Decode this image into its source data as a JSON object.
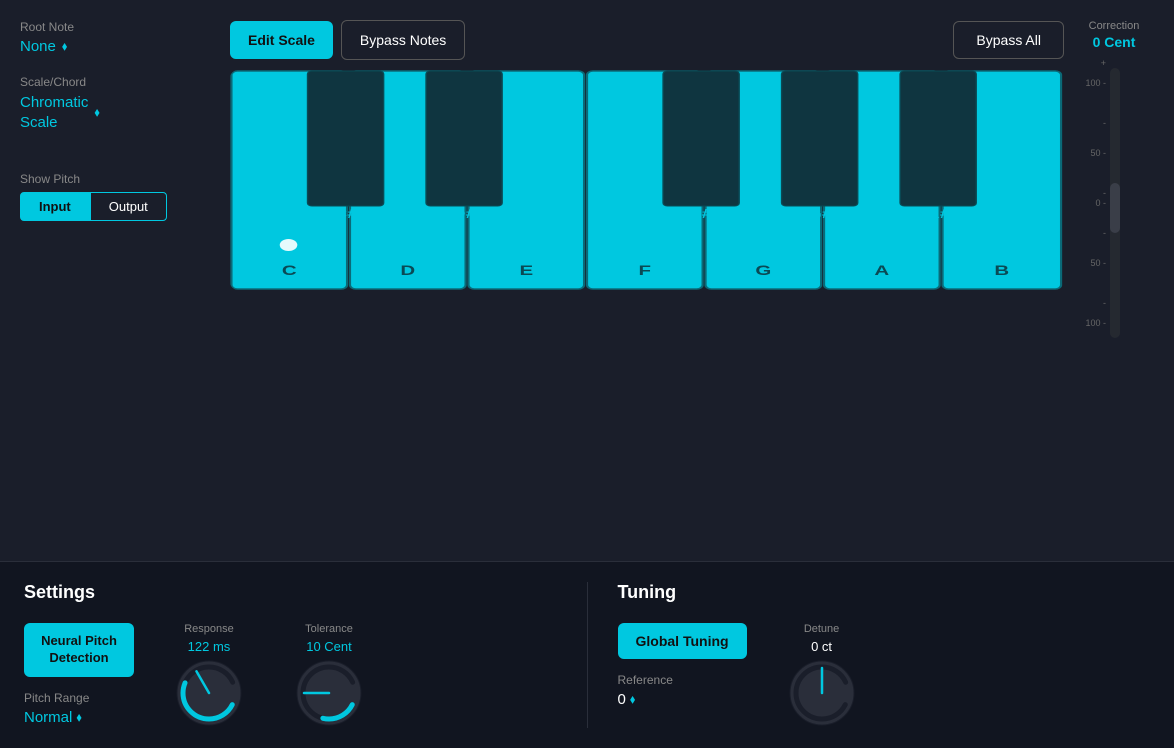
{
  "header": {
    "correction_label": "Correction",
    "correction_value": "0 Cent"
  },
  "left_panel": {
    "root_note_label": "Root Note",
    "root_note_value": "None",
    "scale_chord_label": "Scale/Chord",
    "scale_chord_value": "Chromatic\nScale",
    "scale_chord_line1": "Chromatic",
    "scale_chord_line2": "Scale",
    "show_pitch_label": "Show Pitch",
    "input_btn": "Input",
    "output_btn": "Output"
  },
  "toolbar": {
    "edit_scale_label": "Edit\nScale",
    "bypass_notes_label": "Bypass\nNotes",
    "bypass_all_label": "Bypass\nAll"
  },
  "piano": {
    "white_keys": [
      "C",
      "D",
      "E",
      "F",
      "G",
      "A",
      "B"
    ],
    "black_keys": [
      "C#",
      "D#",
      "",
      "F#",
      "G#",
      "A#"
    ]
  },
  "correction_scale": {
    "markers": [
      "+",
      "100 -",
      "-",
      "50 -",
      "-",
      "0 -",
      "-",
      "50 -",
      "-",
      "100 -",
      "-"
    ]
  },
  "settings": {
    "title": "Settings",
    "neural_pitch_btn": "Neural Pitch\nDetection",
    "neural_pitch_line1": "Neural Pitch",
    "neural_pitch_line2": "Detection",
    "pitch_range_label": "Pitch Range",
    "pitch_range_value": "Normal",
    "response_label": "Response",
    "response_value": "122 ms",
    "tolerance_label": "Tolerance",
    "tolerance_value": "10 Cent"
  },
  "tuning": {
    "title": "Tuning",
    "global_tuning_btn": "Global Tuning",
    "reference_label": "Reference",
    "reference_value": "0",
    "detune_label": "Detune",
    "detune_value": "0 ct"
  }
}
